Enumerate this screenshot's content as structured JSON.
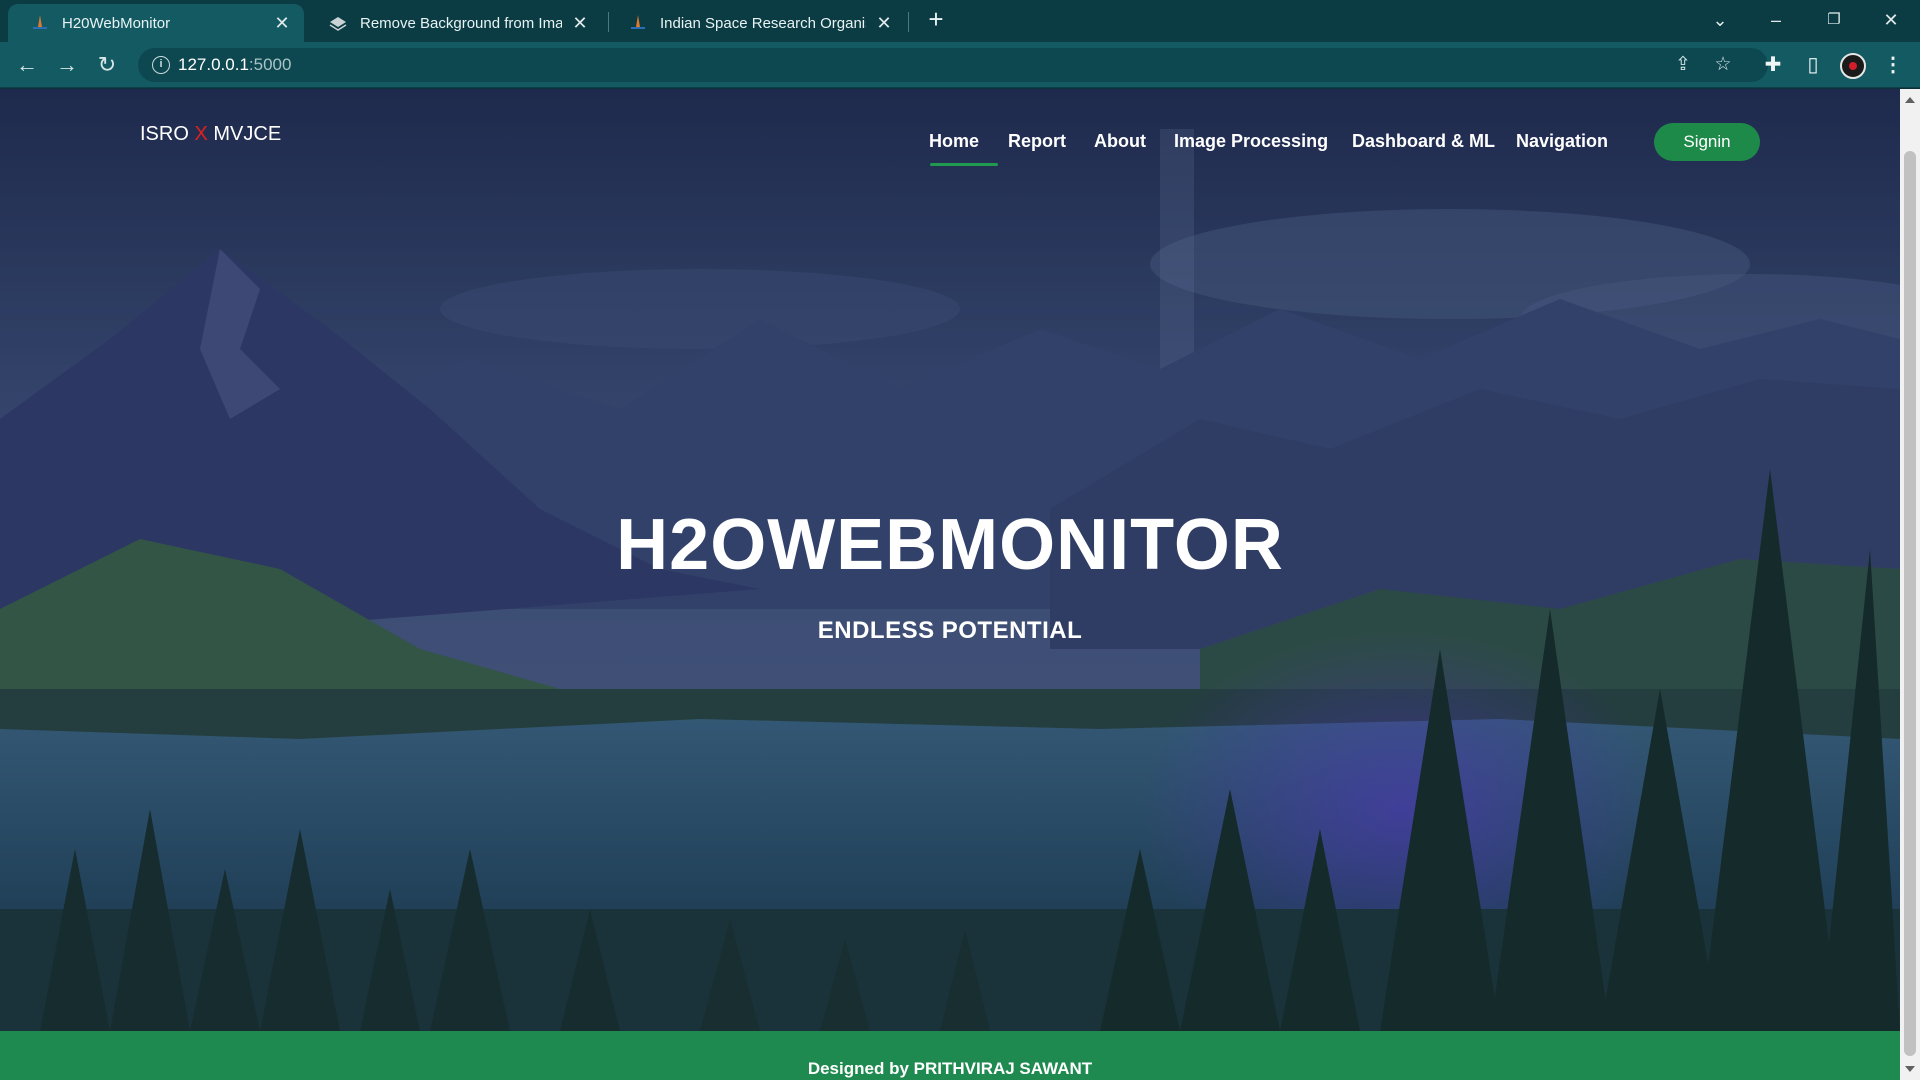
{
  "browser": {
    "tabs": [
      {
        "title": "H20WebMonitor",
        "active": true
      },
      {
        "title": "Remove Background from Image",
        "active": false
      },
      {
        "title": "Indian Space Research Organisati",
        "active": false
      }
    ],
    "new_tab_icon": "plus-icon",
    "address": {
      "host": "127.0.0.1",
      "port": ":5000"
    },
    "toolbar_icons": [
      "back-icon",
      "forward-icon",
      "reload-icon",
      "share-icon",
      "star-icon",
      "extensions-icon",
      "side-panel-icon",
      "profile-avatar",
      "menu-icon"
    ],
    "window_controls": [
      "tab-search-icon",
      "minimize-icon",
      "restore-icon",
      "close-icon"
    ]
  },
  "site": {
    "brand": {
      "left": "ISRO",
      "x": "X",
      "right": "MVJCE"
    },
    "nav": {
      "items": [
        "Home",
        "Report",
        "About",
        "Image Processing",
        "Dashboard & ML",
        "Navigation"
      ],
      "active": "Home",
      "signin": "Signin"
    },
    "hero": {
      "title": "H2OWEBMONITOR",
      "subtitle": "ENDLESS POTENTIAL"
    },
    "footer": {
      "text": "Designed by PRITHVIRAJ SAWANT"
    }
  },
  "colors": {
    "accent": "#1e8a4a",
    "brand_x": "#e02020",
    "tab_bar": "#0b3b43",
    "toolbar": "#135a63"
  }
}
